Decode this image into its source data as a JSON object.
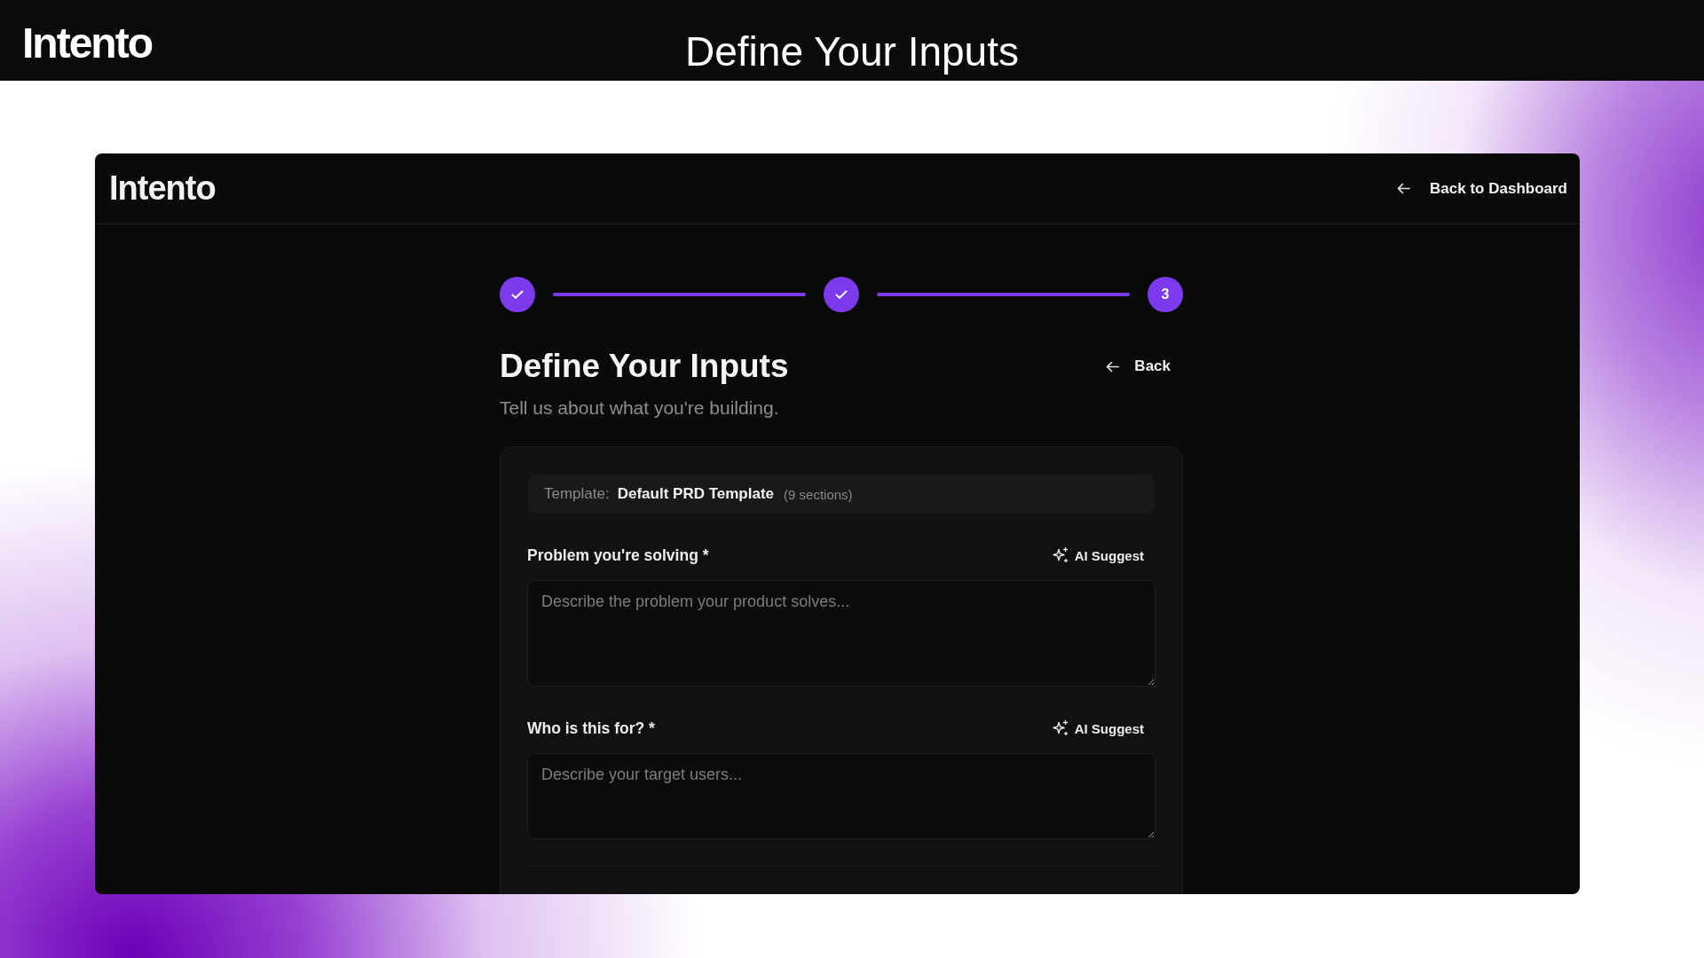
{
  "slide": {
    "logo": "Intento",
    "title": "Define Your Inputs"
  },
  "app": {
    "header": {
      "logo": "Intento",
      "back_link": "Back to Dashboard"
    },
    "stepper": {
      "steps": [
        {
          "completed": true
        },
        {
          "completed": true
        },
        {
          "completed": false,
          "number": "3"
        }
      ]
    },
    "heading": {
      "title": "Define Your Inputs",
      "subtitle": "Tell us about what you're building.",
      "back_button": "Back"
    },
    "form": {
      "template": {
        "label": "Template:",
        "name": "Default PRD Template",
        "sections": "(9 sections)"
      },
      "fields": [
        {
          "label": "Problem you're solving *",
          "suggest_button": "AI Suggest",
          "placeholder": "Describe the problem your product solves..."
        },
        {
          "label": "Who is this for? *",
          "suggest_button": "AI Suggest",
          "placeholder": "Describe your target users..."
        }
      ]
    }
  }
}
